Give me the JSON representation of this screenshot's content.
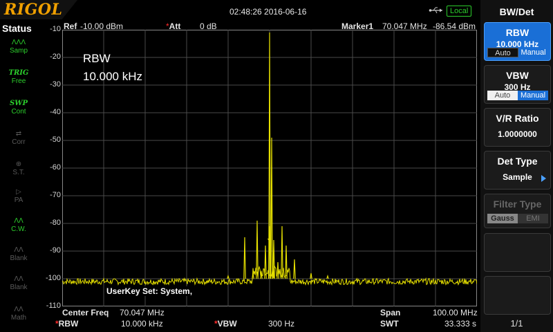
{
  "brand": "RIGOL",
  "datetime": "02:48:26 2016-06-16",
  "connection": "Local",
  "icons": {
    "usb": "usb-icon",
    "arrow": "arrow-right-icon"
  },
  "colors": {
    "trace": "#e6e000",
    "grid": "#4a4a4a",
    "accent": "#1a6fd6",
    "status_green": "#2ccf2c"
  },
  "header": {
    "ref_label": "Ref",
    "ref_value": "-10.00 dBm",
    "att_label": "Att",
    "att_value": "0 dB",
    "marker_label": "Marker1",
    "marker_freq": "70.047 MHz",
    "marker_amp": "-86.54 dBm"
  },
  "status": {
    "title": "Status",
    "items": [
      {
        "icon": "wave-icon",
        "glyph": "ΛΛΛ",
        "label": "Samp",
        "active": true
      },
      {
        "icon": "trig-icon",
        "glyph": "TRIG",
        "label": "Free",
        "active": true
      },
      {
        "icon": "swp-icon",
        "glyph": "SWP",
        "label": "Cont",
        "active": true
      },
      {
        "icon": "corr-icon",
        "glyph": "⇄",
        "label": "Corr",
        "active": false
      },
      {
        "icon": "st-icon",
        "glyph": "⊕",
        "label": "S.T.",
        "active": false
      },
      {
        "icon": "pa-icon",
        "glyph": "▷",
        "label": "PA",
        "active": false
      },
      {
        "icon": "cw-icon",
        "glyph": "ΛΛ",
        "label": "C.W.",
        "active": true
      },
      {
        "icon": "blank1-icon",
        "glyph": "ΛΛ",
        "label": "Blank",
        "active": false
      },
      {
        "icon": "blank2-icon",
        "glyph": "ΛΛ",
        "label": "Blank",
        "active": false
      },
      {
        "icon": "math-icon",
        "glyph": "ΛΛ",
        "label": "Math",
        "active": false
      }
    ]
  },
  "annotation": {
    "line1": "RBW",
    "line2": "10.000 kHz"
  },
  "userkey": "UserKey Set:   System,",
  "chart_data": {
    "type": "line",
    "xlabel": "",
    "ylabel": "",
    "xlim": [
      20.047,
      120.047
    ],
    "ylim": [
      -110,
      -10
    ],
    "yticks": [
      "-10",
      "-20",
      "-30",
      "-40",
      "-50",
      "-60",
      "-70",
      "-80",
      "-90",
      "-100",
      "-110"
    ],
    "grid": true,
    "noise_floor": -101,
    "peaks": [
      {
        "x": 60.05,
        "y": -99
      },
      {
        "x": 64.05,
        "y": -85
      },
      {
        "x": 66.05,
        "y": -98
      },
      {
        "x": 67.05,
        "y": -79
      },
      {
        "x": 68.05,
        "y": -98
      },
      {
        "x": 69.05,
        "y": -88
      },
      {
        "x": 70.0,
        "y": -81
      },
      {
        "x": 70.047,
        "y": -11
      },
      {
        "x": 70.55,
        "y": -49
      },
      {
        "x": 71.05,
        "y": -86
      },
      {
        "x": 72.05,
        "y": -94
      },
      {
        "x": 73.05,
        "y": -81
      },
      {
        "x": 74.05,
        "y": -88
      },
      {
        "x": 76.05,
        "y": -93
      },
      {
        "x": 80.05,
        "y": -98
      },
      {
        "x": 84.05,
        "y": -99
      }
    ]
  },
  "bottom": {
    "center_label": "Center Freq",
    "center_value": "70.047 MHz",
    "span_label": "Span",
    "span_value": "100.00 MHz",
    "rbw_label": "RBW",
    "rbw_value": "10.000 kHz",
    "vbw_label": "VBW",
    "vbw_value": "300 Hz",
    "swt_label": "SWT",
    "swt_value": "33.333 s"
  },
  "menu": {
    "title": "BW/Det",
    "rbw": {
      "label": "RBW",
      "value": "10.000 kHz",
      "auto": "Auto",
      "manual": "Manual"
    },
    "vbw": {
      "label": "VBW",
      "value": "300 Hz",
      "auto": "Auto",
      "manual": "Manual"
    },
    "vr": {
      "label": "V/R Ratio",
      "value": "1.0000000"
    },
    "det": {
      "label": "Det Type",
      "value": "Sample"
    },
    "filter": {
      "label": "Filter Type",
      "gauss": "Gauss",
      "emi": "EMI"
    },
    "page": "1/1"
  }
}
